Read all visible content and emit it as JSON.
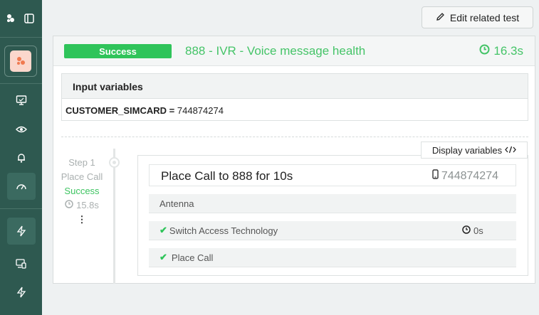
{
  "header": {
    "edit_button_label": "Edit related test"
  },
  "card": {
    "status_badge": "Success",
    "test_title": "888 - IVR - Voice message health",
    "duration": "16.3s"
  },
  "inputs": {
    "heading": "Input variables",
    "variable_name": "CUSTOMER_SIMCARD",
    "variable_separator": " = ",
    "variable_value": "744874274"
  },
  "step": {
    "label": "Step 1",
    "name": "Place Call",
    "status": "Success",
    "duration": "15.8s",
    "menu_glyph": "⋮",
    "display_vars_label": "Display variables",
    "action_title": "Place Call to 888 for 10s",
    "action_phone": "744874274",
    "substeps": [
      {
        "label": "Antenna",
        "checked": false,
        "duration": ""
      },
      {
        "label": "Switch Access Technology",
        "checked": true,
        "duration": "0s"
      },
      {
        "label": "Place Call",
        "checked": true,
        "duration": ""
      }
    ],
    "check_glyph": "✔"
  },
  "colors": {
    "sidebar": "#2e5950",
    "success": "#2fc45a"
  }
}
